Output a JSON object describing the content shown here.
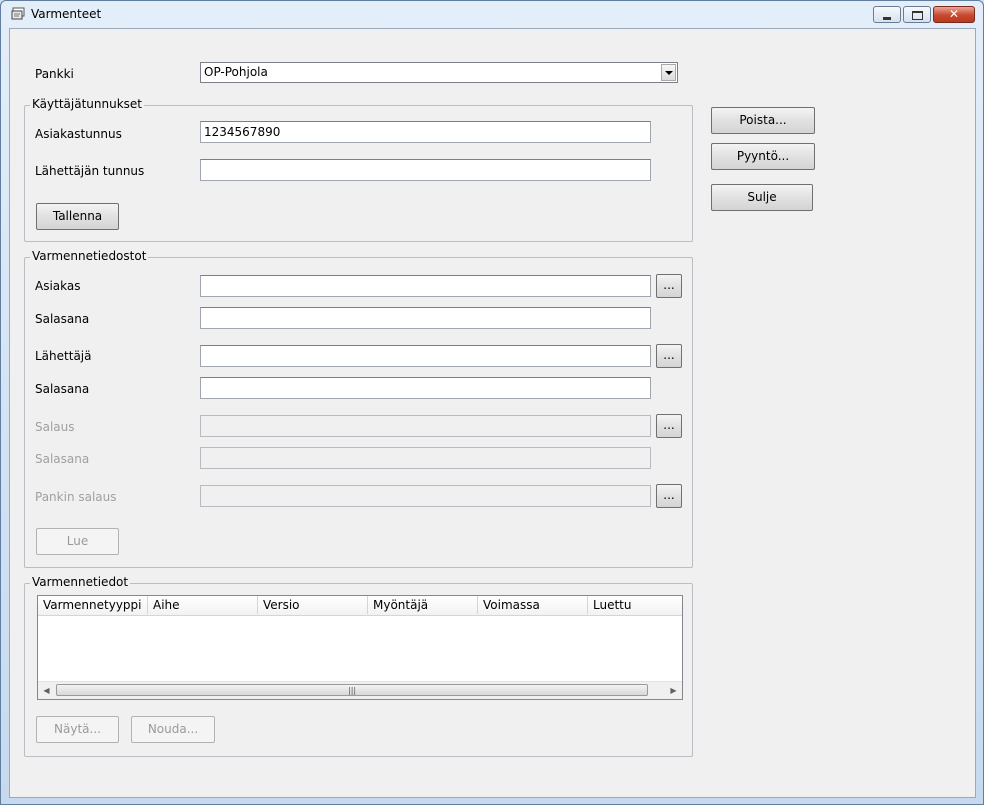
{
  "window": {
    "title": "Varmenteet"
  },
  "bank": {
    "label": "Pankki",
    "selected": "OP-Pohjola"
  },
  "credentials": {
    "legend": "Käyttäjätunnukset",
    "customer_id_label": "Asiakastunnus",
    "customer_id_value": "1234567890",
    "sender_id_label": "Lähettäjän tunnus",
    "sender_id_value": "",
    "save_label": "Tallenna"
  },
  "side_buttons": {
    "delete": "Poista...",
    "request": "Pyyntö...",
    "close": "Sulje"
  },
  "cert_files": {
    "legend": "Varmennetiedostot",
    "customer_label": "Asiakas",
    "customer_password_label": "Salasana",
    "sender_label": "Lähettäjä",
    "sender_password_label": "Salasana",
    "encryption_label": "Salaus",
    "encryption_password_label": "Salasana",
    "bank_encryption_label": "Pankin salaus",
    "browse_label": "...",
    "read_label": "Lue"
  },
  "cert_info": {
    "legend": "Varmennetiedot",
    "columns": [
      "Varmennetyyppi",
      "Aihe",
      "Versio",
      "Myöntäjä",
      "Voimassa",
      "Luettu"
    ],
    "show_label": "Näytä...",
    "fetch_label": "Nouda..."
  },
  "icons": {
    "app": "certificate-icon",
    "minimize": "minimize-icon",
    "maximize": "maximize-icon",
    "close": "close-icon"
  }
}
